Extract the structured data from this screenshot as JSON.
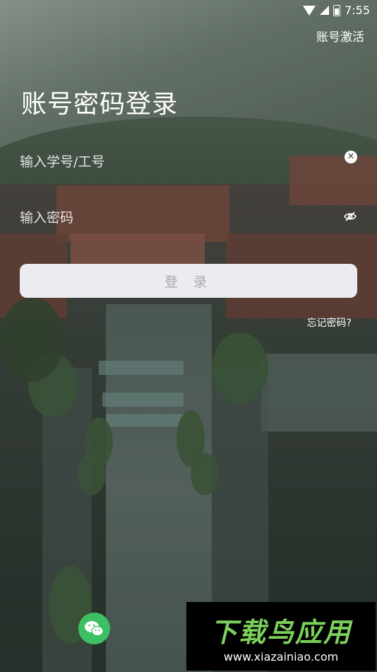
{
  "status_bar": {
    "time": "7:55"
  },
  "header": {
    "activate_label": "账号激活",
    "title": "账号密码登录"
  },
  "form": {
    "id_placeholder": "输入学号/工号",
    "id_value": "",
    "password_placeholder": "输入密码",
    "password_value": "",
    "login_label": "登 录",
    "forgot_label": "忘记密码?"
  },
  "icons": {
    "clear": "clear-icon",
    "eye": "eye-off-icon",
    "wechat": "wechat-icon"
  },
  "colors": {
    "login_bg": "#ececf0",
    "login_text": "#a8a8ae",
    "wechat": "#3cc063",
    "watermark_text": "#7bd05a"
  },
  "watermark": {
    "title": "下载鸟应用",
    "url": "www.xiazainiao.com"
  }
}
